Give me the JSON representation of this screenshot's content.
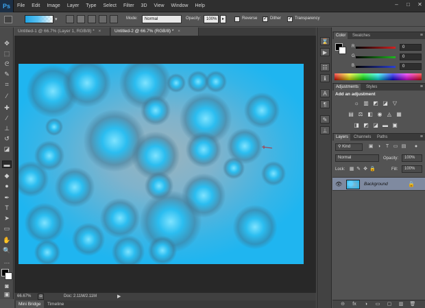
{
  "app": {
    "logo": "Ps"
  },
  "menu": [
    "File",
    "Edit",
    "Image",
    "Layer",
    "Type",
    "Select",
    "Filter",
    "3D",
    "View",
    "Window",
    "Help"
  ],
  "window_controls": [
    "–",
    "□",
    "✕"
  ],
  "options_bar": {
    "mode_label": "Mode:",
    "mode_value": "Normal",
    "opacity_label": "Opacity:",
    "opacity_value": "100%",
    "reverse_label": "Reverse",
    "dither_label": "Dither",
    "transparency_label": "Transparency",
    "reverse_checked": false,
    "dither_checked": true,
    "transparency_checked": true
  },
  "document_tabs": [
    {
      "title": "Untitled-1 @ 66.7% (Layer 1, RGB/8) *",
      "active": false
    },
    {
      "title": "Untitled-2 @ 66.7% (RGB/8) *",
      "active": true
    }
  ],
  "status_bar": {
    "zoom": "66.67%",
    "doc_info": "Doc: 2.11M/2.11M"
  },
  "bottom_tabs": [
    "Mini Bridge",
    "Timeline"
  ],
  "color_panel": {
    "tabs": [
      "Color",
      "Swatches"
    ],
    "r_label": "R",
    "g_label": "G",
    "b_label": "B",
    "r_value": "0",
    "g_value": "0",
    "b_value": "0",
    "colors": {
      "r_track": "#d42020",
      "g_track": "#1fb81f",
      "b_track": "#2a3fd6"
    }
  },
  "adjustments_panel": {
    "tabs": [
      "Adjustments",
      "Styles"
    ],
    "title": "Add an adjustment",
    "icons_row1": [
      "☼",
      "▥",
      "◩",
      "◪",
      "▽"
    ],
    "icons_row2": [
      "▤",
      "⚖",
      "◧",
      "◉",
      "◬",
      "▦"
    ],
    "icons_row3": [
      "◨",
      "◩",
      "◪",
      "▬",
      "▣"
    ]
  },
  "layers_panel": {
    "tabs": [
      "Layers",
      "Channels",
      "Paths"
    ],
    "filter_label": "Kind",
    "blend_mode": "Normal",
    "opacity_label": "Opacity:",
    "opacity_value": "100%",
    "lock_label": "Lock:",
    "fill_label": "Fill:",
    "fill_value": "100%",
    "layers": [
      {
        "name": "Background",
        "visible": true,
        "locked": true
      }
    ],
    "footer_icons": [
      "⊝",
      "fx",
      "◑",
      "▭",
      "▢",
      "▥",
      "🗑"
    ]
  },
  "canvas_colors": {
    "highlight": "#7ee3ff",
    "mid": "#2bbdf0",
    "base": "#1fb5f0"
  }
}
